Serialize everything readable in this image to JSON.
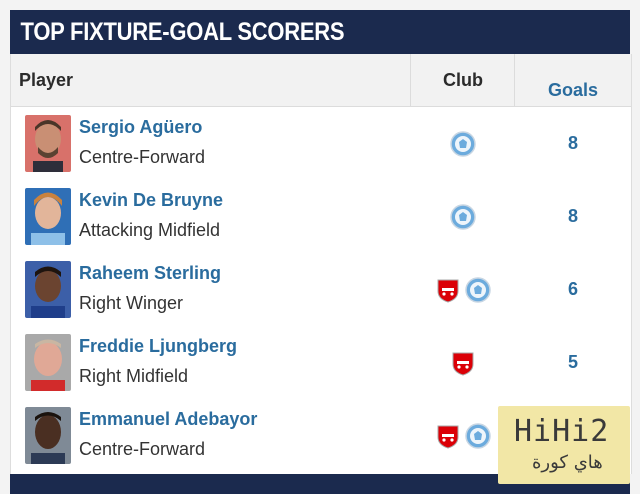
{
  "header": {
    "title": "Top Fixture-Goal Scorers"
  },
  "table": {
    "columns": {
      "player": "Player",
      "club": "Club",
      "goals": "Goals"
    },
    "rows": [
      {
        "name": "Sergio Agüero",
        "position": "Centre-Forward",
        "clubs": [
          "man-city"
        ],
        "goals": "8"
      },
      {
        "name": "Kevin De Bruyne",
        "position": "Attacking Midfield",
        "clubs": [
          "man-city"
        ],
        "goals": "8"
      },
      {
        "name": "Raheem Sterling",
        "position": "Right Winger",
        "clubs": [
          "arsenal",
          "man-city"
        ],
        "goals": "6"
      },
      {
        "name": "Freddie Ljungberg",
        "position": "Right Midfield",
        "clubs": [
          "arsenal"
        ],
        "goals": "5"
      },
      {
        "name": "Emmanuel Adebayor",
        "position": "Centre-Forward",
        "clubs": [
          "arsenal",
          "man-city"
        ],
        "goals": ""
      }
    ]
  },
  "watermark": {
    "logo": "HiHi2",
    "arabic": "هاي كورة"
  },
  "colors": {
    "banner": "#1b2a4e",
    "link": "#2a6c9e",
    "arsenal": "#db0007",
    "man_city": "#6cabdd"
  }
}
